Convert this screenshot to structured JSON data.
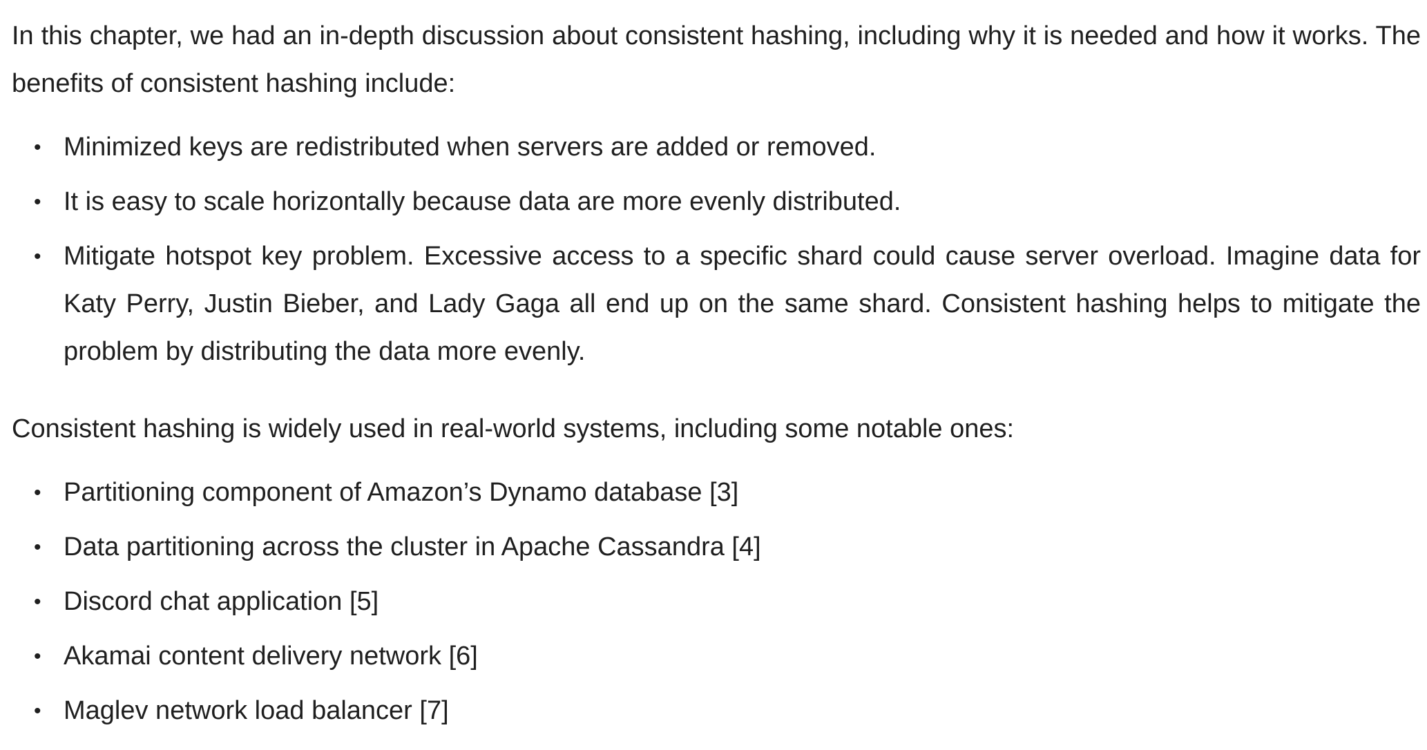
{
  "document": {
    "intro": "In this chapter, we had an in-depth discussion about consistent hashing, including why it is needed and how it works. The benefits of consistent hashing include:",
    "benefits": [
      "Minimized keys are redistributed when servers are added or removed.",
      "It is easy to scale horizontally because data are more evenly distributed.",
      "Mitigate hotspot key problem. Excessive access to a specific shard could cause server overload. Imagine data for Katy Perry, Justin Bieber, and Lady Gaga all end up on the same shard. Consistent hashing helps to mitigate the problem by distributing the data more evenly."
    ],
    "usage_intro": "Consistent hashing is widely used in real-world systems, including some notable ones:",
    "systems": [
      "Partitioning component of Amazon’s Dynamo database [3]",
      "Data partitioning across the cluster in Apache Cassandra [4]",
      "Discord chat application [5]",
      "Akamai content delivery network [6]",
      "Maglev network load balancer [7]"
    ],
    "bullet_glyph": "•"
  }
}
